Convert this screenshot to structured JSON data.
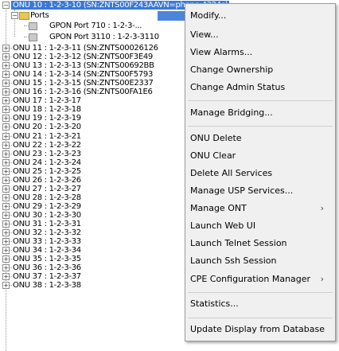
{
  "tree": {
    "selected_item": "ONU 10 : 1-2-3-10 (SN:ZNTS00F243AAVN=phone-4324s)",
    "ports_label": "Ports",
    "port_rows": [
      "GPON Port 710 : 1-2-3-...",
      "GPON Port 3110 : 1-2-3-3110"
    ],
    "onu_rows": [
      "ONU 11 : 1-2-3-11 (SN:ZNTS00026126",
      "ONU 12 : 1-2-3-12 (SN:ZNTS00F3E49",
      "ONU 13 : 1-2-3-13 (SN:ZNTS00692BB",
      "ONU 14 : 1-2-3-14 (SN:ZNTS00F5793",
      "ONU 15 : 1-2-3-15 (SN:ZNTS00E2337",
      "ONU 16 : 1-2-3-16 (SN:ZNTS00FA1E6",
      "ONU 17 : 1-2-3-17",
      "ONU 18 : 1-2-3-18",
      "ONU 19 : 1-2-3-19",
      "ONU 20 : 1-2-3-20",
      "ONU 21 : 1-2-3-21",
      "ONU 22 : 1-2-3-22",
      "ONU 23 : 1-2-3-23",
      "ONU 24 : 1-2-3-24",
      "ONU 25 : 1-2-3-25",
      "ONU 26 : 1-2-3-26",
      "ONU 27 : 1-2-3-27",
      "ONU 28 : 1-2-3-28",
      "ONU 29 : 1-2-3-29",
      "ONU 30 : 1-2-3-30",
      "ONU 31 : 1-2-3-31",
      "ONU 32 : 1-2-3-32",
      "ONU 33 : 1-2-3-33",
      "ONU 34 : 1-2-3-34",
      "ONU 35 : 1-2-3-35",
      "ONU 36 : 1-2-3-36",
      "ONU 37 : 1-2-3-37",
      "ONU 38 : 1-2-3-38"
    ]
  },
  "context_menu": {
    "modify": "Modify...",
    "view": "View...",
    "view_alarms": "View Alarms...",
    "change_ownership": "Change Ownership",
    "change_admin_status": "Change Admin Status",
    "manage_bridging": "Manage Bridging...",
    "onu_delete": "ONU Delete",
    "onu_clear": "ONU Clear",
    "delete_all_services": "Delete All Services",
    "manage_usp_services": "Manage USP Services...",
    "manage_ont": "Manage ONT",
    "launch_web_ui": "Launch Web UI",
    "launch_telnet_session": "Launch Telnet Session",
    "launch_ssh_session": "Launch Ssh Session",
    "cpe_configuration_manager": "CPE Configuration Manager",
    "statistics": "Statistics...",
    "update_display_from_database": "Update Display from Database",
    "submenu_arrow": "›"
  },
  "colors": {
    "selection": "#3a78d6",
    "menu_background": "#f0f0f0"
  }
}
